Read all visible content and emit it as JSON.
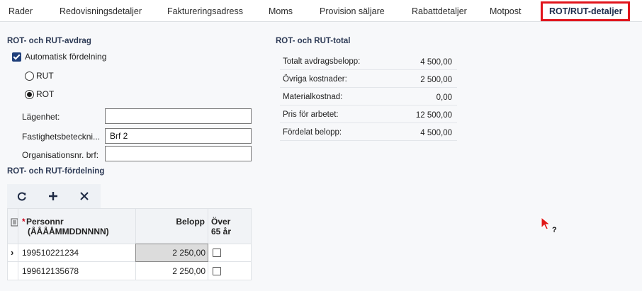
{
  "tabs": [
    {
      "label": "Rader"
    },
    {
      "label": "Redovisningsdetaljer"
    },
    {
      "label": "Faktureringsadress"
    },
    {
      "label": "Moms"
    },
    {
      "label": "Provision säljare"
    },
    {
      "label": "Rabattdetaljer"
    },
    {
      "label": "Motpost"
    },
    {
      "label": "ROT/RUT-detaljer"
    }
  ],
  "deduction": {
    "title": "ROT- och RUT-avdrag",
    "auto_label": "Automatisk fördelning",
    "auto_checked": true,
    "rut_label": "RUT",
    "rot_label": "ROT",
    "selected": "ROT",
    "fields": [
      {
        "label": "Lägenhet:",
        "value": ""
      },
      {
        "label": "Fastighetsbeteckni...",
        "value": "Brf 2"
      },
      {
        "label": "Organisationsnr. brf:",
        "value": ""
      }
    ]
  },
  "totals": {
    "title": "ROT- och RUT-total",
    "rows": [
      {
        "label": "Totalt avdragsbelopp:",
        "value": "4 500,00"
      },
      {
        "label": "Övriga kostnader:",
        "value": "2 500,00"
      },
      {
        "label": "Materialkostnad:",
        "value": "0,00"
      },
      {
        "label": "Pris för arbetet:",
        "value": "12 500,00"
      },
      {
        "label": "Fördelat belopp:",
        "value": "4 500,00"
      }
    ]
  },
  "distribution": {
    "title": "ROT- och RUT-fördelning",
    "columns": {
      "personnr_required": "*",
      "personnr": "Personnr",
      "personnr_format": "(ÅÅÅÅMMDDNNNN)",
      "amount": "Belopp",
      "over65_line1": "Över",
      "over65_line2": "65 år"
    },
    "rows": [
      {
        "personnr": "199510221234",
        "amount": "2 250,00",
        "over65": false
      },
      {
        "personnr": "199612135678",
        "amount": "2 250,00",
        "over65": false
      }
    ]
  },
  "colors": {
    "accent": "#233a77",
    "highlight": "#e1141c",
    "required": "#d0021b"
  }
}
